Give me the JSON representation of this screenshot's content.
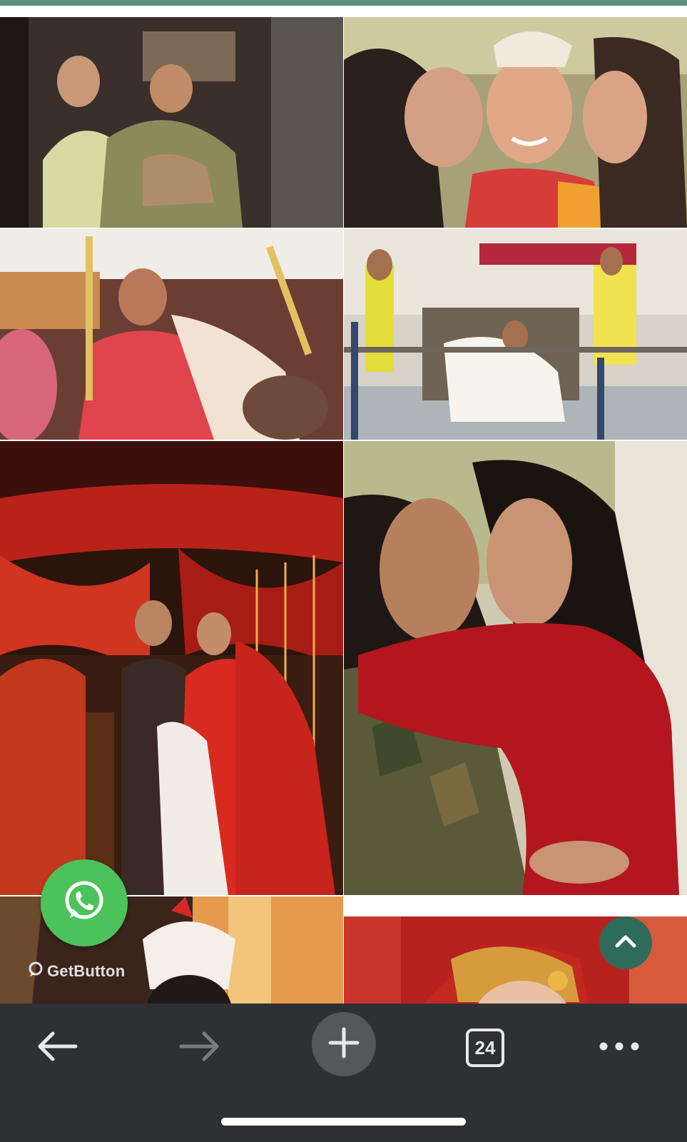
{
  "gallery": {
    "photos": [
      {
        "name": "couple-dance-photo"
      },
      {
        "name": "bride-kissed-by-friends-photo"
      },
      {
        "name": "bride-under-canopy-photo"
      },
      {
        "name": "bride-on-palanquin-photo"
      },
      {
        "name": "couple-mandap-photo"
      },
      {
        "name": "couple-embrace-photo"
      },
      {
        "name": "bride-crown-photo"
      },
      {
        "name": "bride-veil-photo"
      }
    ]
  },
  "widgets": {
    "whatsapp_icon": "whatsapp-icon",
    "getbutton_label": "GetButton",
    "scroll_top_icon": "chevron-up-icon"
  },
  "browser_bar": {
    "tab_count": "24",
    "icons": [
      "arrow-left-icon",
      "arrow-right-icon",
      "plus-icon",
      "tabs-icon",
      "more-dots-icon"
    ]
  },
  "colors": {
    "accent": "#5a8f7b",
    "whatsapp": "#4cc35a",
    "scroll_top": "#2f6b5a",
    "toolbar": "#2f3033"
  }
}
